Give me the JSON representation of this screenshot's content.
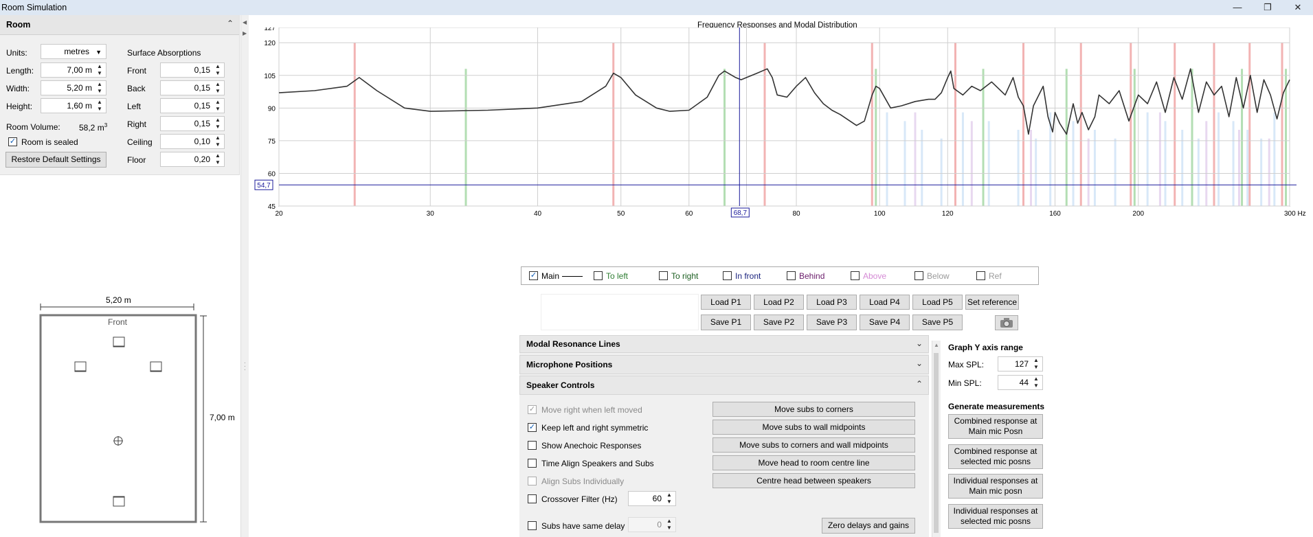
{
  "window": {
    "title": "Room Simulation",
    "minimize": "—",
    "restore": "❐",
    "close": "✕"
  },
  "room": {
    "header": "Room",
    "units_label": "Units:",
    "units_value": "metres",
    "length_label": "Length:",
    "length_value": "7,00 m",
    "width_label": "Width:",
    "width_value": "5,20 m",
    "height_label": "Height:",
    "height_value": "1,60 m",
    "volume_label": "Room Volume:",
    "volume_value": "58,2 m",
    "volume_sup": "3",
    "sealed_label": "Room is sealed",
    "restore_button": "Restore Default Settings",
    "surface_title": "Surface Absorptions",
    "surfaces": [
      {
        "label": "Front",
        "value": "0,15"
      },
      {
        "label": "Back",
        "value": "0,15"
      },
      {
        "label": "Left",
        "value": "0,15"
      },
      {
        "label": "Right",
        "value": "0,15"
      },
      {
        "label": "Ceiling",
        "value": "0,10"
      },
      {
        "label": "Floor",
        "value": "0,20"
      }
    ]
  },
  "diagram": {
    "width_label": "5,20 m",
    "length_label": "7,00 m",
    "front_label": "Front"
  },
  "chart_data": {
    "type": "line",
    "title": "Frequency Responses and Modal Distribution",
    "xlabel": "",
    "ylabel": "",
    "x_scale": "log",
    "xlim": [
      20,
      300
    ],
    "ylim": [
      45,
      127
    ],
    "x_ticks": [
      20,
      30,
      40,
      50,
      60,
      70,
      80,
      100,
      120,
      160,
      200,
      300
    ],
    "x_tick_labels": [
      "20",
      "30",
      "40",
      "50",
      "60",
      "",
      "80",
      "100",
      "120",
      "160",
      "200",
      "300 Hz"
    ],
    "y_ticks": [
      45,
      60,
      75,
      90,
      105,
      120,
      127
    ],
    "y_tick_labels": [
      "45",
      "60",
      "75",
      "90",
      "105",
      "120",
      "127"
    ],
    "grid": true,
    "cursor": {
      "x": 68.7,
      "y": 54.7,
      "x_label": "68,7",
      "y_label": "54,7"
    },
    "series": [
      {
        "name": "Main",
        "color": "#333333",
        "x": [
          20,
          22,
          24,
          24.8,
          26,
          28,
          30,
          35,
          40,
          45,
          48,
          49,
          50,
          52,
          55,
          57,
          60,
          63,
          65,
          66,
          68,
          69,
          70,
          72,
          74,
          75,
          76,
          78,
          80,
          82,
          84,
          86,
          88,
          90,
          94,
          96,
          98,
          99,
          100,
          103,
          106,
          110,
          114,
          116,
          118,
          120,
          121,
          122,
          125,
          128,
          131,
          135,
          140,
          143,
          145,
          147,
          149,
          151,
          155,
          157,
          159,
          160,
          162,
          165,
          168,
          170,
          172,
          175,
          178,
          180,
          185,
          190,
          195,
          200,
          205,
          210,
          215,
          220,
          225,
          230,
          235,
          240,
          245,
          250,
          255,
          260,
          265,
          270,
          275,
          280,
          285,
          290,
          295,
          300
        ],
        "y": [
          97,
          98,
          100,
          104,
          98,
          90,
          88.5,
          89,
          90,
          93,
          100,
          106,
          104,
          96,
          90,
          88.5,
          89,
          95,
          105,
          107,
          104,
          103,
          104,
          106,
          108,
          104,
          96,
          95,
          100,
          104,
          97,
          92,
          89,
          87,
          82,
          84,
          96,
          100,
          99,
          90,
          91,
          93,
          94,
          94,
          97,
          104,
          107,
          99,
          96,
          100,
          98,
          102,
          96,
          104,
          95,
          91,
          78,
          91,
          100,
          86,
          79,
          88,
          83,
          78,
          92,
          83,
          88,
          80,
          86,
          96,
          92,
          98,
          84,
          96,
          92,
          102,
          88,
          104,
          94,
          108,
          88,
          102,
          96,
          100,
          86,
          104,
          90,
          105,
          88,
          103,
          96,
          85,
          97,
          103
        ]
      }
    ],
    "modal_lines": [
      {
        "color": "#f2b3b3",
        "x": [
          24.5,
          49,
          73.5,
          98,
          122.5,
          147,
          171.5,
          196,
          220.5,
          245,
          269.5,
          294
        ]
      },
      {
        "color": "#b3deb3",
        "x": [
          33,
          66,
          99,
          132,
          165,
          198,
          231,
          264,
          297
        ]
      },
      {
        "color": "#d8e8f8",
        "x": [
          102,
          107,
          112,
          118,
          125,
          134,
          145,
          152,
          158,
          168,
          178,
          188,
          205,
          215,
          225,
          235,
          248,
          258,
          268,
          278,
          288
        ]
      },
      {
        "color": "#e8d8f0",
        "x": [
          110,
          128,
          150,
          175,
          212,
          240,
          262,
          284
        ]
      }
    ]
  },
  "legend": [
    {
      "label": "Main",
      "checked": true,
      "color": "#000000"
    },
    {
      "label": "To left",
      "checked": false,
      "color": "#2e7d32"
    },
    {
      "label": "To right",
      "checked": false,
      "color": "#1b5e20"
    },
    {
      "label": "In front",
      "checked": false,
      "color": "#1a237e"
    },
    {
      "label": "Behind",
      "checked": false,
      "color": "#6a1b6a"
    },
    {
      "label": "Above",
      "checked": false,
      "color": "#d58ad5"
    },
    {
      "label": "Below",
      "checked": false,
      "color": "#999999"
    },
    {
      "label": "Ref",
      "checked": false,
      "color": "#999999"
    }
  ],
  "load_buttons": [
    "Load P1",
    "Load P2",
    "Load P3",
    "Load P4",
    "Load P5",
    "Set reference"
  ],
  "save_buttons": [
    "Save P1",
    "Save P2",
    "Save P3",
    "Save P4",
    "Save P5"
  ],
  "sections": {
    "modal": "Modal Resonance Lines",
    "mic": "Microphone Positions",
    "speaker": "Speaker Controls"
  },
  "speaker": {
    "checks": [
      {
        "label": "Move right when left moved",
        "checked": true,
        "disabled": true
      },
      {
        "label": "Keep left and right symmetric",
        "checked": true,
        "disabled": false
      },
      {
        "label": "Show Anechoic Responses",
        "checked": false,
        "disabled": false
      },
      {
        "label": "Time Align Speakers and Subs",
        "checked": false,
        "disabled": false
      },
      {
        "label": "Align Subs Individually",
        "checked": false,
        "disabled": true
      },
      {
        "label": "Crossover Filter (Hz)",
        "checked": false,
        "disabled": false
      },
      {
        "label": "Subs have same delay",
        "checked": false,
        "disabled": false
      }
    ],
    "crossover_value": "60",
    "delay_value": "0",
    "buttons": [
      "Move subs to corners",
      "Move subs to wall midpoints",
      "Move subs to corners and wall midpoints",
      "Move head to room centre line",
      "Centre head between speakers"
    ],
    "zero_button": "Zero delays and gains"
  },
  "graph_y": {
    "title": "Graph Y axis range",
    "max_label": "Max SPL:",
    "max_value": "127",
    "min_label": "Min SPL:",
    "min_value": "44"
  },
  "generate": {
    "title": "Generate measurements",
    "buttons": [
      [
        "Combined response at",
        "Main mic Posn"
      ],
      [
        "Combined response at",
        "selected mic posns"
      ],
      [
        "Individual responses at",
        "Main mic posn"
      ],
      [
        "Individual responses at",
        "selected mic posns"
      ]
    ]
  }
}
